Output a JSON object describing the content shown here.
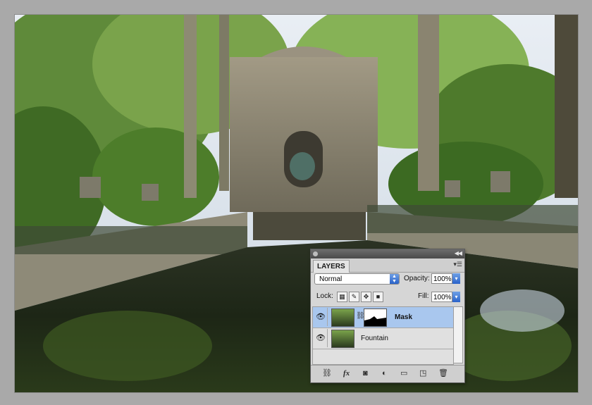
{
  "image": {
    "content": "Medici Fountain with trees, urns, railings and reflecting pool"
  },
  "layers_panel": {
    "tab_label": "LAYERS",
    "menu_icon": "panel-menu-icon",
    "blend_mode": "Normal",
    "opacity_label": "Opacity:",
    "opacity_value": "100%",
    "lock_label": "Lock:",
    "fill_label": "Fill:",
    "fill_value": "100%",
    "layers": [
      {
        "name": "Mask",
        "visible": true,
        "selected": true,
        "has_mask": true
      },
      {
        "name": "Fountain",
        "visible": true,
        "selected": false,
        "has_mask": false
      }
    ],
    "footer_icons": [
      "link-layers-icon",
      "fx-icon",
      "add-mask-icon",
      "adjustment-layer-icon",
      "new-group-icon",
      "new-layer-icon",
      "trash-icon"
    ],
    "fx_text": "fx",
    "colors": {
      "selected_row": "#a9c7ee",
      "panel_bg": "#d6d6d6",
      "accent": "#2a63c9"
    }
  }
}
